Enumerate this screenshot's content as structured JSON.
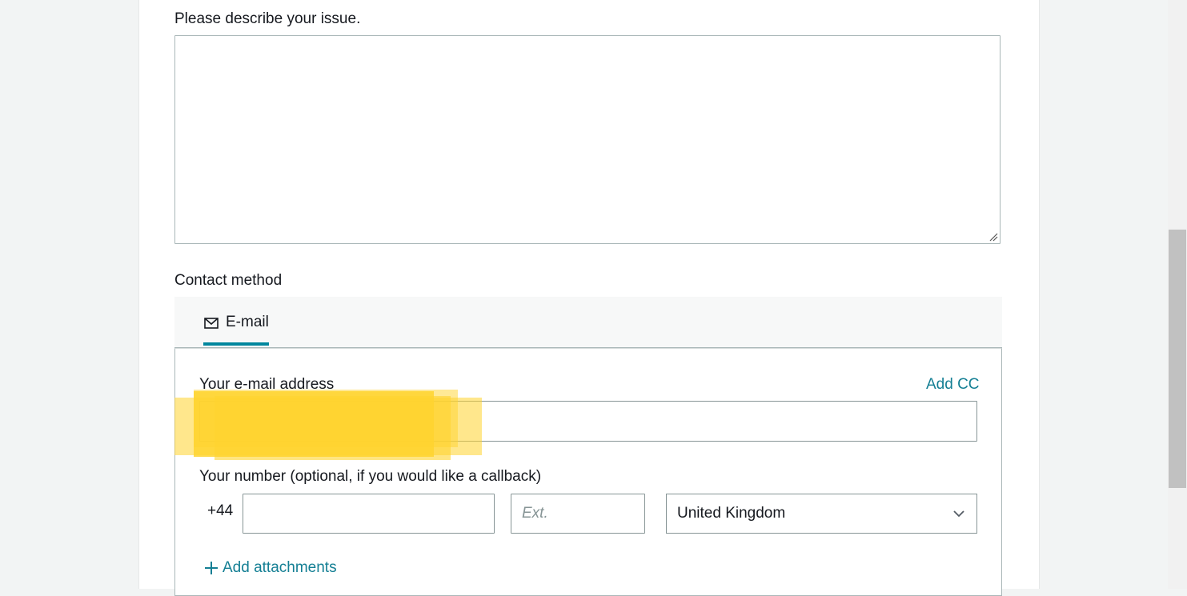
{
  "issue": {
    "label": "Please describe your issue.",
    "value": ""
  },
  "contact": {
    "section_label": "Contact method",
    "tabs": [
      {
        "label": "E-mail",
        "icon": "mail-icon",
        "selected": true
      }
    ],
    "email": {
      "label": "Your e-mail address",
      "add_cc": "Add CC",
      "value": ""
    },
    "phone": {
      "label": "Your number (optional, if you would like a callback)",
      "prefix": "+44",
      "number_value": "",
      "ext_placeholder": "Ext.",
      "country_selected": "United Kingdom"
    },
    "add_attachments": "Add attachments"
  },
  "colors": {
    "accent": "#00879e",
    "link": "#147f94",
    "redaction": "#ffd42e"
  }
}
